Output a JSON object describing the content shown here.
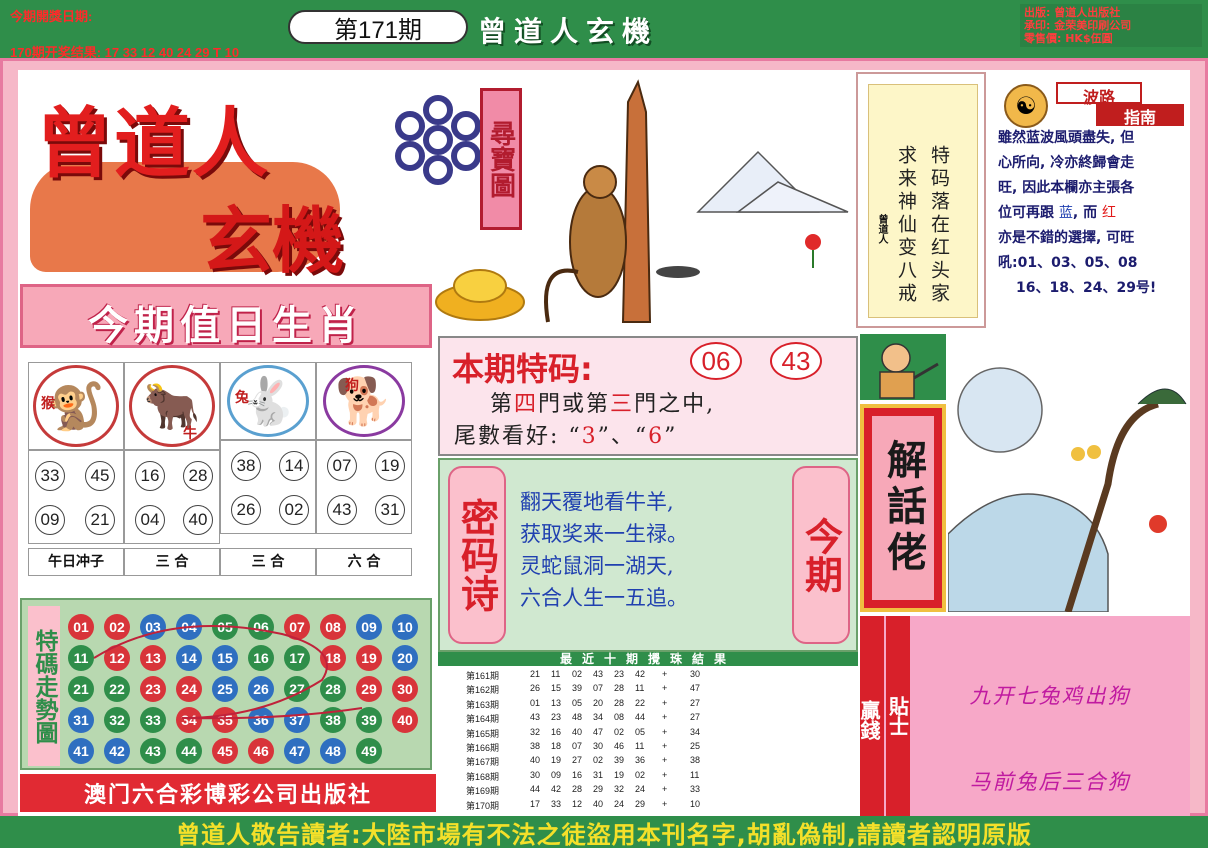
{
  "header": {
    "date_line": "今期開獎日期:",
    "result_line": "170期开奖结果: 17 33 12 40 24 29 T 10",
    "issue": "第171期",
    "title": "曾道人玄機",
    "publisher_info": [
      "出版: 曾道人出版社",
      "承印: 金荣美印刷公司",
      "零售價: HK$伍圓"
    ]
  },
  "logo": {
    "line1": "曾道人",
    "line2": "玄機",
    "treasure_label": "尋寶圖"
  },
  "poem_vertical": {
    "columns": [
      "特码落在红头家",
      "求来神仙变八戒"
    ],
    "signature": "曾道人"
  },
  "guide": {
    "label1": "波路",
    "label2": "指南",
    "lines": [
      {
        "text": "雖然蓝波風頭盡失, 但"
      },
      {
        "text": "心所向, 冷亦終歸會走"
      },
      {
        "text": "旺, 因此本欄亦主張各"
      },
      {
        "text": "位可再跟"
      },
      {
        "text": "亦是不錯的選擇, 可旺"
      },
      {
        "text": "吼:01、03、05、08"
      },
      {
        "text": "16、18、24、29号!"
      }
    ],
    "blue_word": "蓝",
    "and_word": ", 而",
    "red_word": "红"
  },
  "zodiac": {
    "title": "今期值日生肖",
    "cells": [
      {
        "animal": "猴",
        "glyph": "🐒",
        "numbers": [
          "33",
          "45",
          "09",
          "21"
        ],
        "caption": "午日冲子"
      },
      {
        "animal": "牛",
        "glyph": "🐂",
        "numbers": [
          "16",
          "28",
          "04",
          "40"
        ],
        "caption": "三 合"
      },
      {
        "animal": "兔",
        "glyph": "🐇",
        "numbers": [
          "38",
          "14",
          "26",
          "02"
        ],
        "caption": "三 合"
      },
      {
        "animal": "狗",
        "glyph": "🐕",
        "numbers": [
          "07",
          "19",
          "43",
          "31"
        ],
        "caption": "六 合"
      }
    ]
  },
  "trend": {
    "label": "特碼走勢圖",
    "balls": [
      [
        "01",
        "red"
      ],
      [
        "02",
        "red"
      ],
      [
        "03",
        "blue"
      ],
      [
        "04",
        "blue"
      ],
      [
        "05",
        "green"
      ],
      [
        "06",
        "green"
      ],
      [
        "07",
        "red"
      ],
      [
        "08",
        "red"
      ],
      [
        "09",
        "blue"
      ],
      [
        "10",
        "blue"
      ],
      [
        "11",
        "green"
      ],
      [
        "12",
        "red"
      ],
      [
        "13",
        "red"
      ],
      [
        "14",
        "blue"
      ],
      [
        "15",
        "blue"
      ],
      [
        "16",
        "green"
      ],
      [
        "17",
        "green"
      ],
      [
        "18",
        "red"
      ],
      [
        "19",
        "red"
      ],
      [
        "20",
        "blue"
      ],
      [
        "21",
        "green"
      ],
      [
        "22",
        "green"
      ],
      [
        "23",
        "red"
      ],
      [
        "24",
        "red"
      ],
      [
        "25",
        "blue"
      ],
      [
        "26",
        "blue"
      ],
      [
        "27",
        "green"
      ],
      [
        "28",
        "green"
      ],
      [
        "29",
        "red"
      ],
      [
        "30",
        "red"
      ],
      [
        "31",
        "blue"
      ],
      [
        "32",
        "green"
      ],
      [
        "33",
        "green"
      ],
      [
        "34",
        "red"
      ],
      [
        "35",
        "red"
      ],
      [
        "36",
        "blue"
      ],
      [
        "37",
        "blue"
      ],
      [
        "38",
        "green"
      ],
      [
        "39",
        "green"
      ],
      [
        "40",
        "red"
      ],
      [
        "41",
        "blue"
      ],
      [
        "42",
        "blue"
      ],
      [
        "43",
        "green"
      ],
      [
        "44",
        "green"
      ],
      [
        "45",
        "red"
      ],
      [
        "46",
        "red"
      ],
      [
        "47",
        "blue"
      ],
      [
        "48",
        "blue"
      ],
      [
        "49",
        "green"
      ]
    ]
  },
  "publisher": "澳门六合彩博彩公司出版社",
  "special": {
    "title": "本期特码:",
    "numbers": [
      "06",
      "43"
    ],
    "line1_pre": "第",
    "line1_a": "四",
    "line1_mid": "門或第",
    "line1_b": "三",
    "line1_post": "門之中,",
    "line2_pre": "尾數看好: “",
    "line2_a": "3",
    "line2_mid": "”、“",
    "line2_b": "6",
    "line2_post": "”"
  },
  "secret": {
    "tag_left": "密码诗",
    "tag_right": "今期",
    "lines": [
      "翻天覆地看牛羊,",
      "获取奖来一生禄。",
      "灵蛇鼠洞一湖天,",
      "六合人生一五追。"
    ]
  },
  "history": {
    "title": "最近十期攪珠結果",
    "rows": [
      {
        "issue": "第161期",
        "nums": [
          "21",
          "11",
          "02",
          "43",
          "23",
          "42"
        ],
        "sp": "30"
      },
      {
        "issue": "第162期",
        "nums": [
          "26",
          "15",
          "39",
          "07",
          "28",
          "11"
        ],
        "sp": "47"
      },
      {
        "issue": "第163期",
        "nums": [
          "01",
          "13",
          "05",
          "20",
          "28",
          "22"
        ],
        "sp": "27"
      },
      {
        "issue": "第164期",
        "nums": [
          "43",
          "23",
          "48",
          "34",
          "08",
          "44"
        ],
        "sp": "27"
      },
      {
        "issue": "第165期",
        "nums": [
          "32",
          "16",
          "40",
          "47",
          "02",
          "05"
        ],
        "sp": "34"
      },
      {
        "issue": "第166期",
        "nums": [
          "38",
          "18",
          "07",
          "30",
          "46",
          "11"
        ],
        "sp": "25"
      },
      {
        "issue": "第167期",
        "nums": [
          "40",
          "19",
          "27",
          "02",
          "39",
          "36"
        ],
        "sp": "38"
      },
      {
        "issue": "第168期",
        "nums": [
          "30",
          "09",
          "16",
          "31",
          "19",
          "02"
        ],
        "sp": "11"
      },
      {
        "issue": "第169期",
        "nums": [
          "44",
          "42",
          "28",
          "29",
          "32",
          "24"
        ],
        "sp": "33"
      },
      {
        "issue": "第170期",
        "nums": [
          "17",
          "33",
          "12",
          "40",
          "24",
          "29"
        ],
        "sp": "10"
      }
    ]
  },
  "explain": "解話佬",
  "tip": {
    "bar1": "贏錢",
    "bar2": "貼士",
    "line1": "九开七兔鸡出狗",
    "line2": "马前兔后三合狗"
  },
  "notice": "曾道人敬告讀者:大陸市場有不法之徒盜用本刊名字,胡亂偽制,請讀者認明原版"
}
